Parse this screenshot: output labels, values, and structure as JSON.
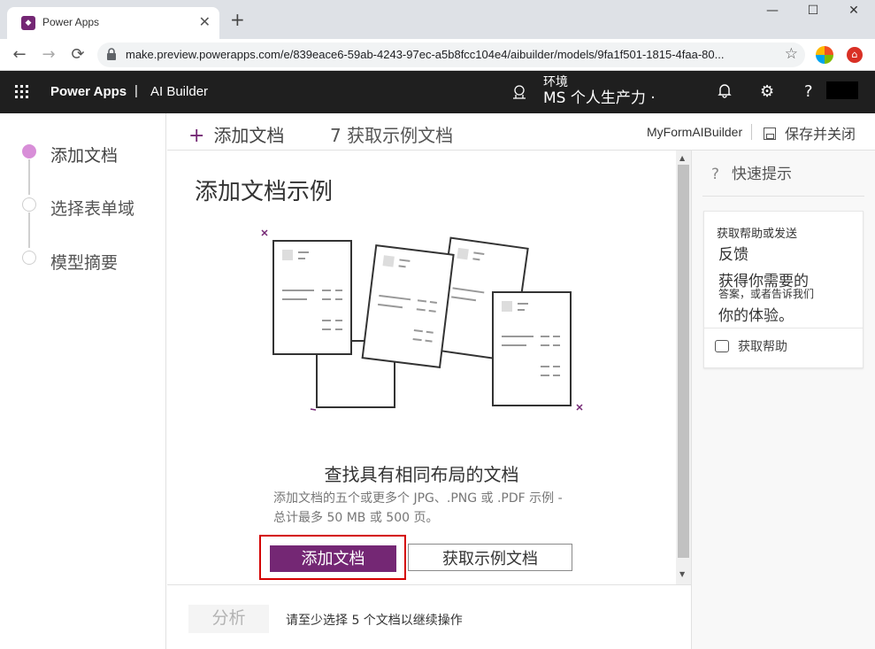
{
  "browser": {
    "tab_title": "Power Apps",
    "tab_close": "✕",
    "new_tab": "+",
    "win_minimize": "—",
    "win_maximize": "☐",
    "win_close": "✕",
    "back": "←",
    "forward": "→",
    "reload": "⟳",
    "url": "make.preview.powerapps.com/e/839eace6-59ab-4243-97ec-a5b8fcc104e4/aibuilder/models/9fa1f501-1815-4faa-80...",
    "bookmark_star": "☆"
  },
  "appbar": {
    "app_name": "Power Apps",
    "separator": "|",
    "section": "AI Builder",
    "env_label": "环境",
    "env_name": "MS 个人生产力 ·",
    "bell": "🔔",
    "gear": "⚙",
    "help": "?"
  },
  "stepper": {
    "steps": [
      {
        "label": "添加文档",
        "active": true
      },
      {
        "label": "选择表单域",
        "active": false
      },
      {
        "label": "模型摘要",
        "active": false
      }
    ]
  },
  "cmdbar": {
    "add_plus": "+",
    "add_label": "添加文档",
    "sample_label": "7 获取示例文档",
    "model_name": "MyFormAIBuilder",
    "save_close": "保存并关闭"
  },
  "main": {
    "title": "添加文档示例",
    "find_title": "查找具有相同布局的文档",
    "find_desc": "添加文档的五个或更多个 JPG、.PNG 或 .PDF 示例 - 总计最多 50 MB 或 500 页。",
    "add_button": "添加文档",
    "sample_button": "获取示例文档"
  },
  "scrollbar": {
    "up": "▲",
    "down": "▼"
  },
  "footer": {
    "analyze": "分析",
    "hint": "请至少选择 5 个文档以继续操作"
  },
  "quicktips": {
    "icon": "?",
    "title": "快速提示",
    "line1": "获取帮助或发送",
    "line2": "反馈",
    "line3": "获得你需要的",
    "line4": "答案，或者告诉我们",
    "line5": "你的体验。",
    "help_link": "获取帮助"
  },
  "colors": {
    "brand": "#742774",
    "active_step": "#d88ed8",
    "highlight": "#d40000",
    "appbar": "#1f1f1f"
  }
}
